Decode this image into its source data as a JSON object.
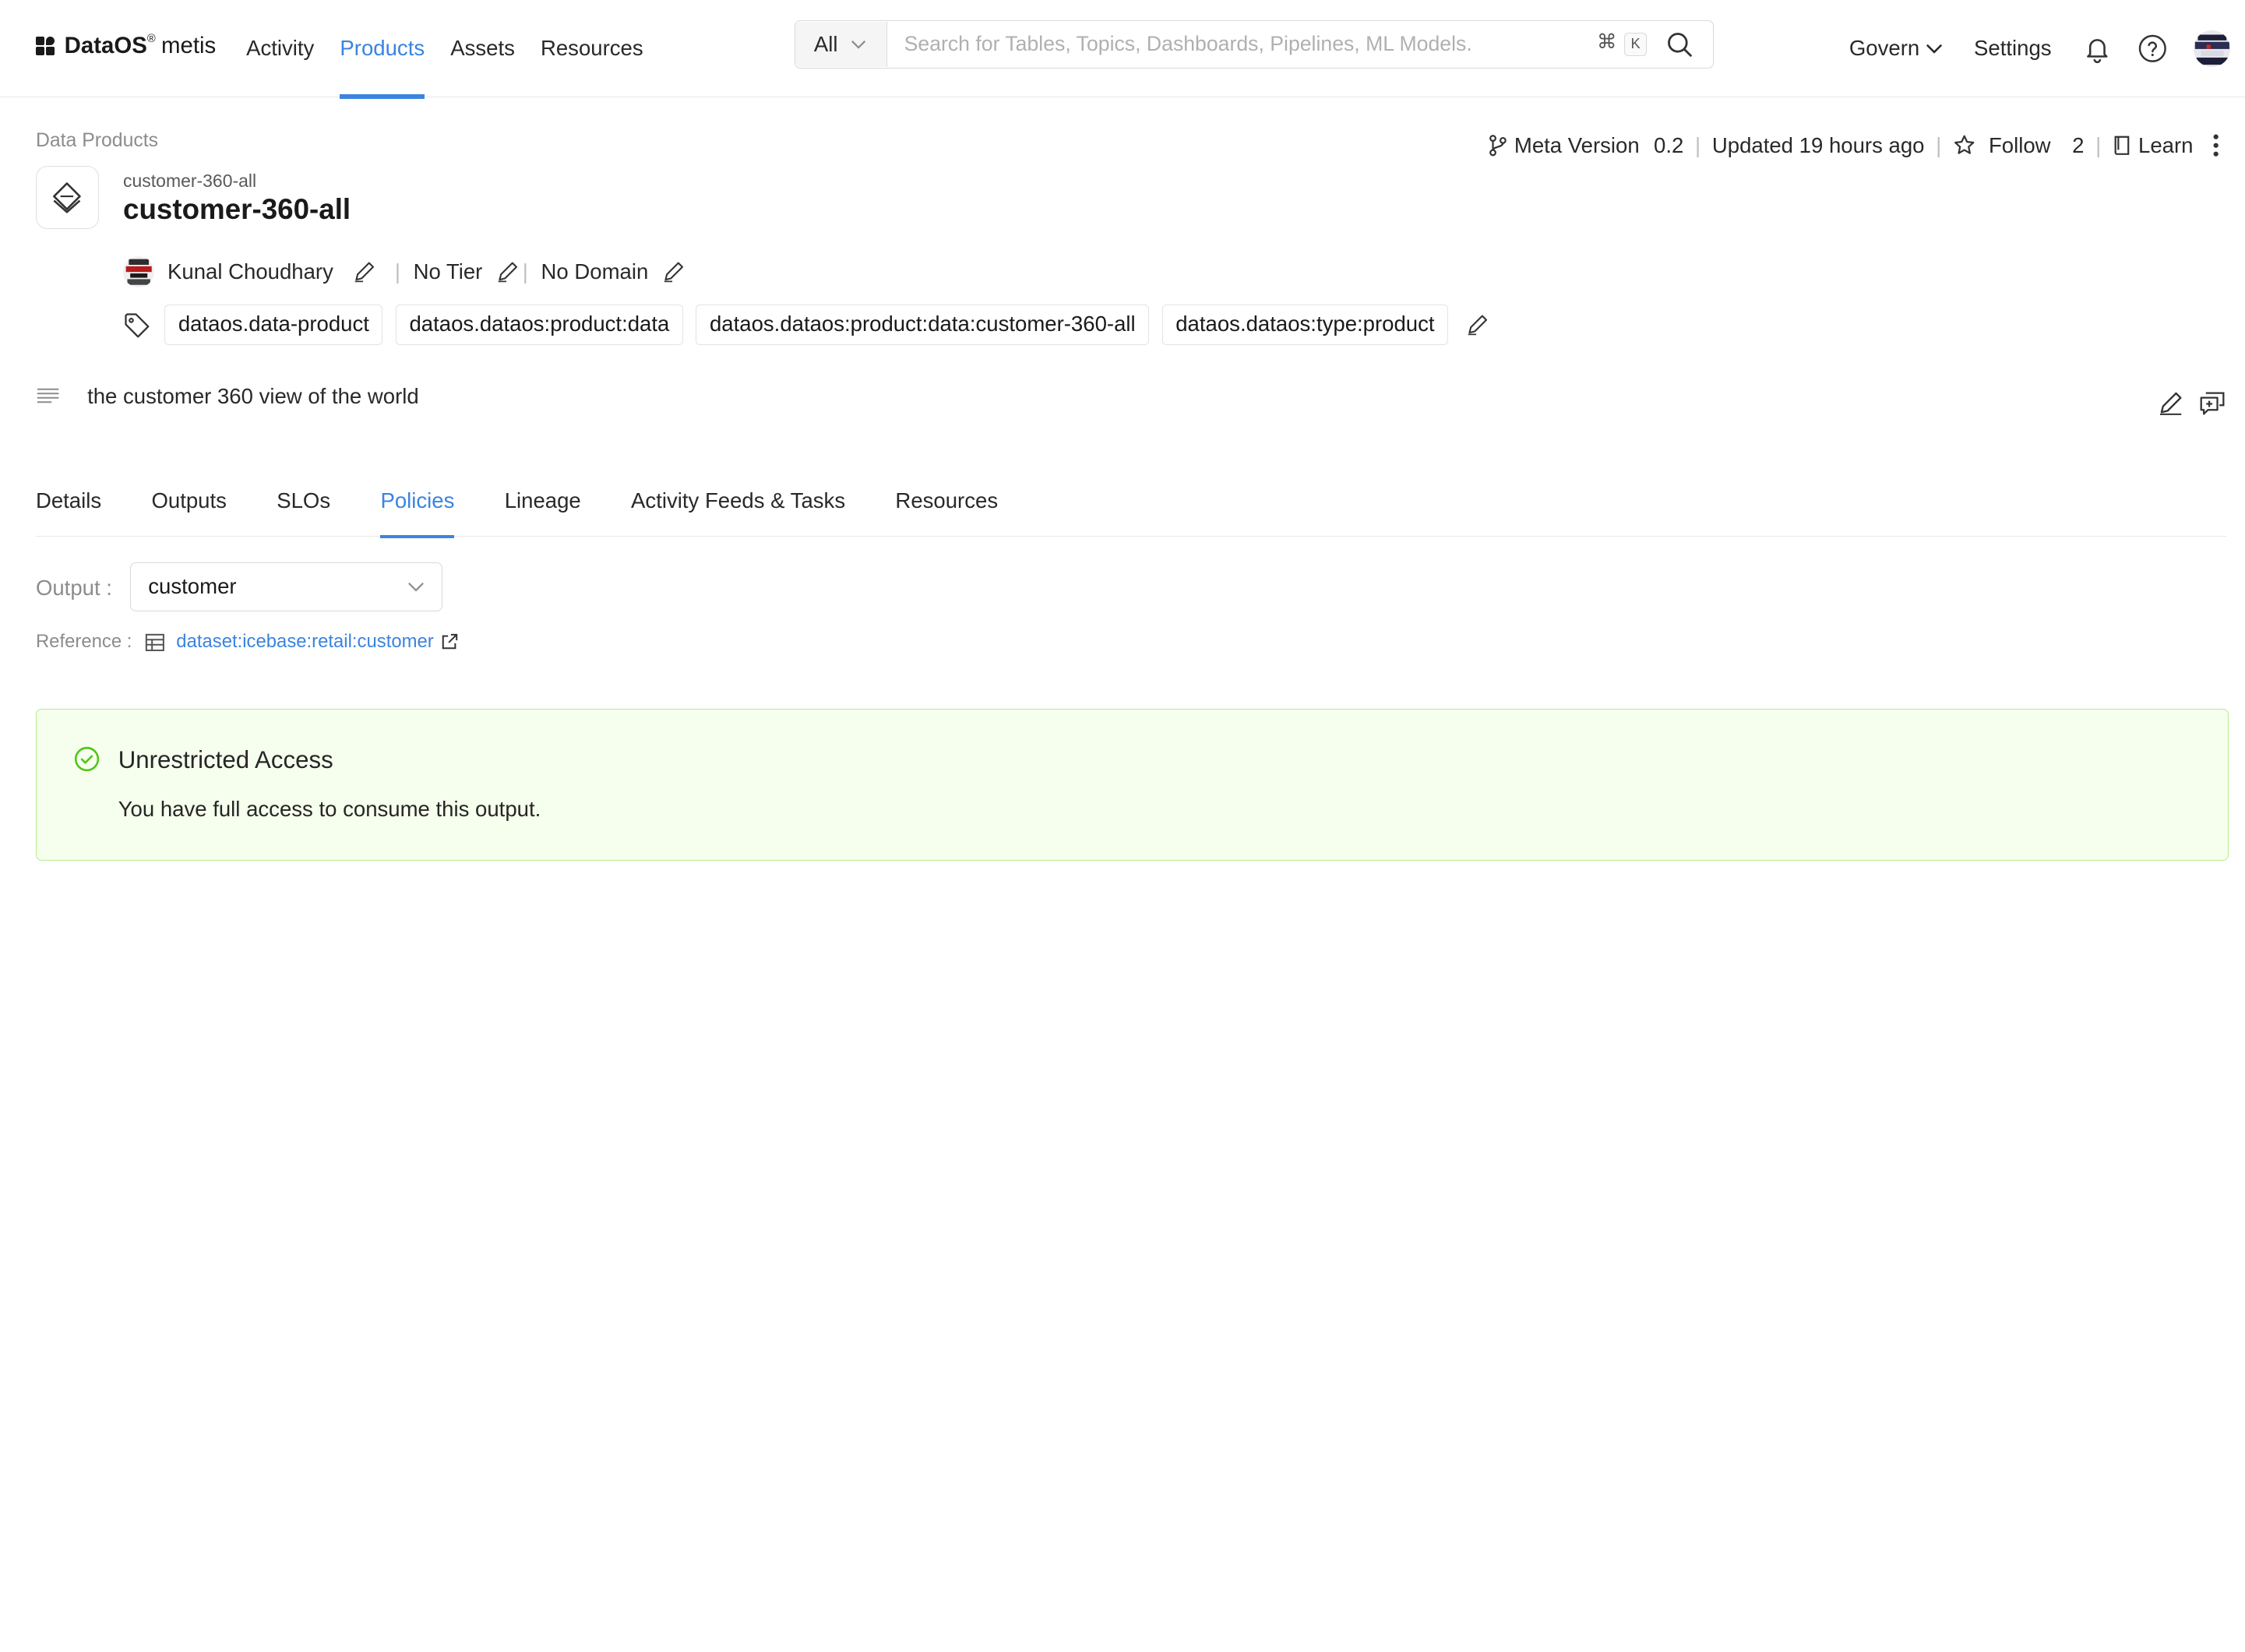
{
  "nav": {
    "logo_brand": "DataOS",
    "logo_reg": "®",
    "logo_product": "metis",
    "items": [
      {
        "label": "Activity",
        "active": false
      },
      {
        "label": "Products",
        "active": true
      },
      {
        "label": "Assets",
        "active": false
      },
      {
        "label": "Resources",
        "active": false
      }
    ],
    "search_scope": "All",
    "search_placeholder": "Search for Tables, Topics, Dashboards, Pipelines, ML Models.",
    "shortcut_cmd": "⌘",
    "shortcut_key": "K",
    "govern": "Govern",
    "settings": "Settings",
    "accent": "#3a84e0"
  },
  "header": {
    "breadcrumb": "Data Products",
    "subtitle": "customer-360-all",
    "title": "customer-360-all",
    "meta_version_label": "Meta Version",
    "meta_version": "0.2",
    "updated": "Updated 19 hours ago",
    "follow_label": "Follow",
    "follow_count": "2",
    "learn": "Learn",
    "owner": "Kunal Choudhary",
    "tier": "No Tier",
    "domain": "No Domain",
    "tags": [
      "dataos.data-product",
      "dataos.dataos:product:data",
      "dataos.dataos:product:data:customer-360-all",
      "dataos.dataos:type:product"
    ],
    "description": "the customer 360 view of the world"
  },
  "tabs": [
    {
      "label": "Details",
      "active": false
    },
    {
      "label": "Outputs",
      "active": false
    },
    {
      "label": "SLOs",
      "active": false
    },
    {
      "label": "Policies",
      "active": true
    },
    {
      "label": "Lineage",
      "active": false
    },
    {
      "label": "Activity Feeds & Tasks",
      "active": false
    },
    {
      "label": "Resources",
      "active": false
    }
  ],
  "policies": {
    "output_label": "Output :",
    "output_value": "customer",
    "reference_label": "Reference :",
    "reference_value": "dataset:icebase:retail:customer",
    "alert_title": "Unrestricted Access",
    "alert_message": "You have full access to consume this output.",
    "alert_color": "#52c41a"
  }
}
